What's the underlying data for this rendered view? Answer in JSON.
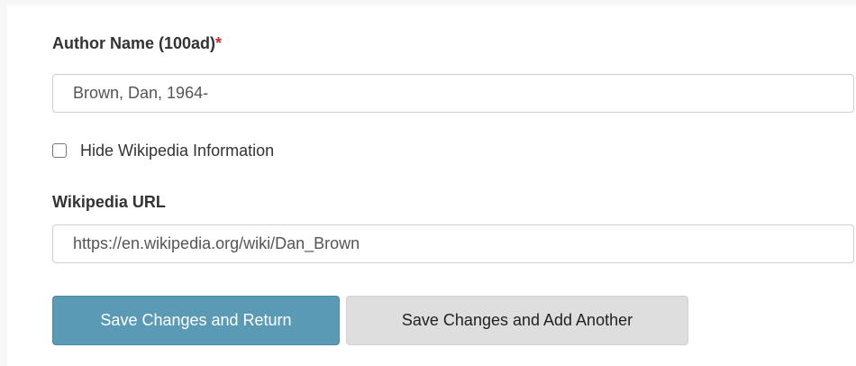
{
  "form": {
    "author_name": {
      "label": "Author Name (100ad)",
      "required_marker": "*",
      "value": "Brown, Dan, 1964-"
    },
    "hide_wikipedia": {
      "label": "Hide Wikipedia Information",
      "checked": false
    },
    "wikipedia_url": {
      "label": "Wikipedia URL",
      "value": "https://en.wikipedia.org/wiki/Dan_Brown"
    },
    "buttons": {
      "save_return": "Save Changes and Return",
      "save_add_another": "Save Changes and Add Another"
    }
  },
  "colors": {
    "primary_button": "#5a9ab4",
    "secondary_button": "#dedede",
    "required_marker": "#c12f2f"
  }
}
